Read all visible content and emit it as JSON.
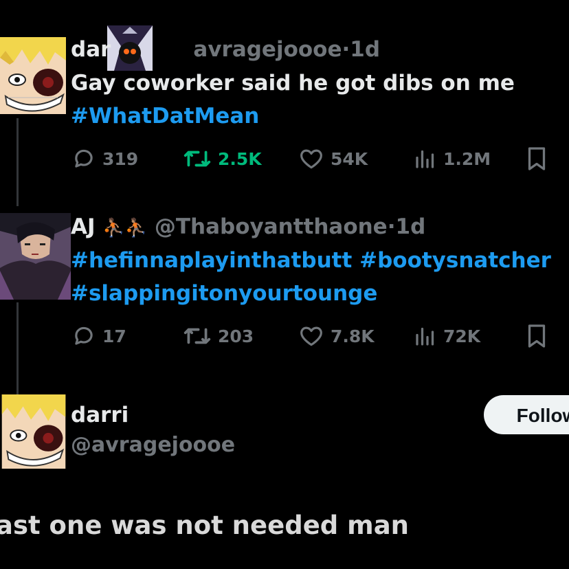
{
  "tweets": [
    {
      "name": "dar",
      "handle": "avragejoooe",
      "dot": "·",
      "time": "1d",
      "text": "Gay coworker said he got dibs on me",
      "hashtags": [
        "#WhatDatMean"
      ],
      "replies": "319",
      "retweets": "2.5K",
      "likes": "54K",
      "views": "1.2M",
      "retweet_color": "#00ba7c"
    },
    {
      "name": "AJ",
      "emoji": "⛹🏽⛹🏽",
      "handle": "@Thaboyantthaone",
      "dot": "·",
      "time": "1d",
      "line1": "#hefinnaplayinthatbutt #bootysnatcher",
      "line2": "#slappingitonyourtounge",
      "replies": "17",
      "retweets": "203",
      "likes": "7.8K",
      "views": "72K"
    }
  ],
  "profile": {
    "name": "darri",
    "handle": "@avragejoooe",
    "follow_label": "Follow"
  },
  "caption": "ast one was not needed man",
  "icons": {
    "reply": "reply-icon",
    "retweet": "retweet-icon",
    "like": "heart-icon",
    "views": "views-icon",
    "bookmark": "bookmark-icon"
  },
  "colors": {
    "background": "#000000",
    "text": "#e7e9ea",
    "muted": "#71767b",
    "link": "#1d9bf0",
    "button_bg": "#eff3f4"
  }
}
